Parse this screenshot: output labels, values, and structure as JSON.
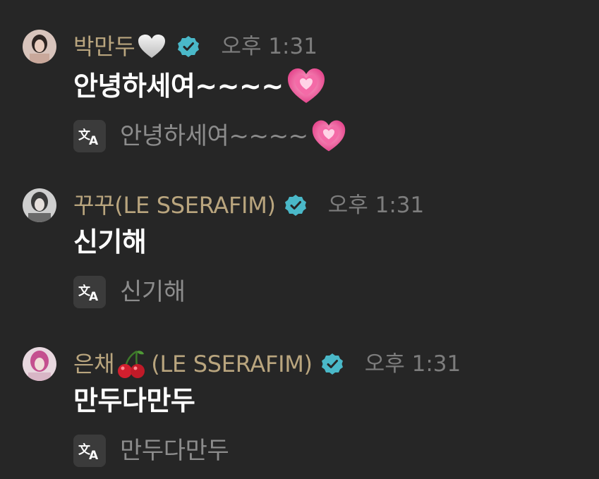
{
  "messages": [
    {
      "author": "박만두",
      "author_suffix": "",
      "time": "오후 1:31",
      "text": "안녕하세여~~~~",
      "translation": "안녕하세여~~~~",
      "avatar_color": "#caa89a"
    },
    {
      "author": "꾸꾸(LE SSERAFIM)",
      "author_suffix": "",
      "time": "오후 1:31",
      "text": "신기해",
      "translation": "신기해",
      "avatar_color": "#9a9a9a"
    },
    {
      "author": "은채",
      "author_suffix": " (LE SSERAFIM)",
      "time": "오후 1:31",
      "text": "만두다만두",
      "translation": "만두다만두",
      "avatar_color": "#d38fb5"
    }
  ],
  "icons": {
    "verified": "verified-badge-icon",
    "translate": "translate-icon",
    "white_heart": "white-heart-icon",
    "pink_heart": "growing-heart-icon",
    "cherry": "cherry-icon"
  },
  "colors": {
    "background": "#262626",
    "author_name": "#b9a57e",
    "timestamp": "#7d7d7d",
    "message_text": "#ffffff",
    "translation_text": "#8c8c8c",
    "verified": "#4ab8c8"
  }
}
